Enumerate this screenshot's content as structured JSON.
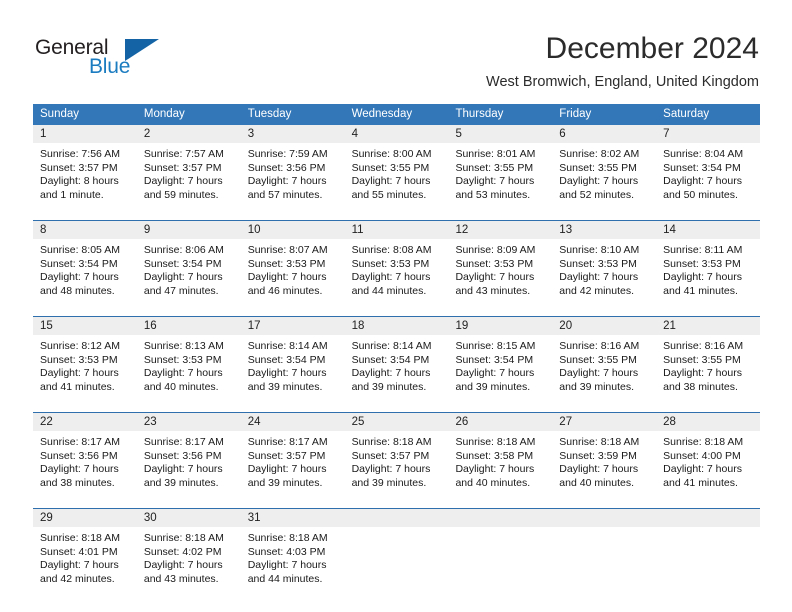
{
  "brand": {
    "name_part1": "General",
    "name_part2": "Blue",
    "triangle_color": "#1464a5",
    "blue_color": "#1c7cc0"
  },
  "header": {
    "month_title": "December 2024",
    "location": "West Bromwich, England, United Kingdom",
    "header_bg_color": "#3377b8",
    "week_rule_color": "#2f6fad",
    "daynum_bg_color": "#eeeeee"
  },
  "weekdays": [
    "Sunday",
    "Monday",
    "Tuesday",
    "Wednesday",
    "Thursday",
    "Friday",
    "Saturday"
  ],
  "weeks": [
    [
      {
        "day": "1",
        "sunrise": "Sunrise: 7:56 AM",
        "sunset": "Sunset: 3:57 PM",
        "daylight1": "Daylight: 8 hours",
        "daylight2": "and 1 minute."
      },
      {
        "day": "2",
        "sunrise": "Sunrise: 7:57 AM",
        "sunset": "Sunset: 3:57 PM",
        "daylight1": "Daylight: 7 hours",
        "daylight2": "and 59 minutes."
      },
      {
        "day": "3",
        "sunrise": "Sunrise: 7:59 AM",
        "sunset": "Sunset: 3:56 PM",
        "daylight1": "Daylight: 7 hours",
        "daylight2": "and 57 minutes."
      },
      {
        "day": "4",
        "sunrise": "Sunrise: 8:00 AM",
        "sunset": "Sunset: 3:55 PM",
        "daylight1": "Daylight: 7 hours",
        "daylight2": "and 55 minutes."
      },
      {
        "day": "5",
        "sunrise": "Sunrise: 8:01 AM",
        "sunset": "Sunset: 3:55 PM",
        "daylight1": "Daylight: 7 hours",
        "daylight2": "and 53 minutes."
      },
      {
        "day": "6",
        "sunrise": "Sunrise: 8:02 AM",
        "sunset": "Sunset: 3:55 PM",
        "daylight1": "Daylight: 7 hours",
        "daylight2": "and 52 minutes."
      },
      {
        "day": "7",
        "sunrise": "Sunrise: 8:04 AM",
        "sunset": "Sunset: 3:54 PM",
        "daylight1": "Daylight: 7 hours",
        "daylight2": "and 50 minutes."
      }
    ],
    [
      {
        "day": "8",
        "sunrise": "Sunrise: 8:05 AM",
        "sunset": "Sunset: 3:54 PM",
        "daylight1": "Daylight: 7 hours",
        "daylight2": "and 48 minutes."
      },
      {
        "day": "9",
        "sunrise": "Sunrise: 8:06 AM",
        "sunset": "Sunset: 3:54 PM",
        "daylight1": "Daylight: 7 hours",
        "daylight2": "and 47 minutes."
      },
      {
        "day": "10",
        "sunrise": "Sunrise: 8:07 AM",
        "sunset": "Sunset: 3:53 PM",
        "daylight1": "Daylight: 7 hours",
        "daylight2": "and 46 minutes."
      },
      {
        "day": "11",
        "sunrise": "Sunrise: 8:08 AM",
        "sunset": "Sunset: 3:53 PM",
        "daylight1": "Daylight: 7 hours",
        "daylight2": "and 44 minutes."
      },
      {
        "day": "12",
        "sunrise": "Sunrise: 8:09 AM",
        "sunset": "Sunset: 3:53 PM",
        "daylight1": "Daylight: 7 hours",
        "daylight2": "and 43 minutes."
      },
      {
        "day": "13",
        "sunrise": "Sunrise: 8:10 AM",
        "sunset": "Sunset: 3:53 PM",
        "daylight1": "Daylight: 7 hours",
        "daylight2": "and 42 minutes."
      },
      {
        "day": "14",
        "sunrise": "Sunrise: 8:11 AM",
        "sunset": "Sunset: 3:53 PM",
        "daylight1": "Daylight: 7 hours",
        "daylight2": "and 41 minutes."
      }
    ],
    [
      {
        "day": "15",
        "sunrise": "Sunrise: 8:12 AM",
        "sunset": "Sunset: 3:53 PM",
        "daylight1": "Daylight: 7 hours",
        "daylight2": "and 41 minutes."
      },
      {
        "day": "16",
        "sunrise": "Sunrise: 8:13 AM",
        "sunset": "Sunset: 3:53 PM",
        "daylight1": "Daylight: 7 hours",
        "daylight2": "and 40 minutes."
      },
      {
        "day": "17",
        "sunrise": "Sunrise: 8:14 AM",
        "sunset": "Sunset: 3:54 PM",
        "daylight1": "Daylight: 7 hours",
        "daylight2": "and 39 minutes."
      },
      {
        "day": "18",
        "sunrise": "Sunrise: 8:14 AM",
        "sunset": "Sunset: 3:54 PM",
        "daylight1": "Daylight: 7 hours",
        "daylight2": "and 39 minutes."
      },
      {
        "day": "19",
        "sunrise": "Sunrise: 8:15 AM",
        "sunset": "Sunset: 3:54 PM",
        "daylight1": "Daylight: 7 hours",
        "daylight2": "and 39 minutes."
      },
      {
        "day": "20",
        "sunrise": "Sunrise: 8:16 AM",
        "sunset": "Sunset: 3:55 PM",
        "daylight1": "Daylight: 7 hours",
        "daylight2": "and 39 minutes."
      },
      {
        "day": "21",
        "sunrise": "Sunrise: 8:16 AM",
        "sunset": "Sunset: 3:55 PM",
        "daylight1": "Daylight: 7 hours",
        "daylight2": "and 38 minutes."
      }
    ],
    [
      {
        "day": "22",
        "sunrise": "Sunrise: 8:17 AM",
        "sunset": "Sunset: 3:56 PM",
        "daylight1": "Daylight: 7 hours",
        "daylight2": "and 38 minutes."
      },
      {
        "day": "23",
        "sunrise": "Sunrise: 8:17 AM",
        "sunset": "Sunset: 3:56 PM",
        "daylight1": "Daylight: 7 hours",
        "daylight2": "and 39 minutes."
      },
      {
        "day": "24",
        "sunrise": "Sunrise: 8:17 AM",
        "sunset": "Sunset: 3:57 PM",
        "daylight1": "Daylight: 7 hours",
        "daylight2": "and 39 minutes."
      },
      {
        "day": "25",
        "sunrise": "Sunrise: 8:18 AM",
        "sunset": "Sunset: 3:57 PM",
        "daylight1": "Daylight: 7 hours",
        "daylight2": "and 39 minutes."
      },
      {
        "day": "26",
        "sunrise": "Sunrise: 8:18 AM",
        "sunset": "Sunset: 3:58 PM",
        "daylight1": "Daylight: 7 hours",
        "daylight2": "and 40 minutes."
      },
      {
        "day": "27",
        "sunrise": "Sunrise: 8:18 AM",
        "sunset": "Sunset: 3:59 PM",
        "daylight1": "Daylight: 7 hours",
        "daylight2": "and 40 minutes."
      },
      {
        "day": "28",
        "sunrise": "Sunrise: 8:18 AM",
        "sunset": "Sunset: 4:00 PM",
        "daylight1": "Daylight: 7 hours",
        "daylight2": "and 41 minutes."
      }
    ],
    [
      {
        "day": "29",
        "sunrise": "Sunrise: 8:18 AM",
        "sunset": "Sunset: 4:01 PM",
        "daylight1": "Daylight: 7 hours",
        "daylight2": "and 42 minutes."
      },
      {
        "day": "30",
        "sunrise": "Sunrise: 8:18 AM",
        "sunset": "Sunset: 4:02 PM",
        "daylight1": "Daylight: 7 hours",
        "daylight2": "and 43 minutes."
      },
      {
        "day": "31",
        "sunrise": "Sunrise: 8:18 AM",
        "sunset": "Sunset: 4:03 PM",
        "daylight1": "Daylight: 7 hours",
        "daylight2": "and 44 minutes."
      },
      {
        "day": "",
        "sunrise": "",
        "sunset": "",
        "daylight1": "",
        "daylight2": ""
      },
      {
        "day": "",
        "sunrise": "",
        "sunset": "",
        "daylight1": "",
        "daylight2": ""
      },
      {
        "day": "",
        "sunrise": "",
        "sunset": "",
        "daylight1": "",
        "daylight2": ""
      },
      {
        "day": "",
        "sunrise": "",
        "sunset": "",
        "daylight1": "",
        "daylight2": ""
      }
    ]
  ]
}
